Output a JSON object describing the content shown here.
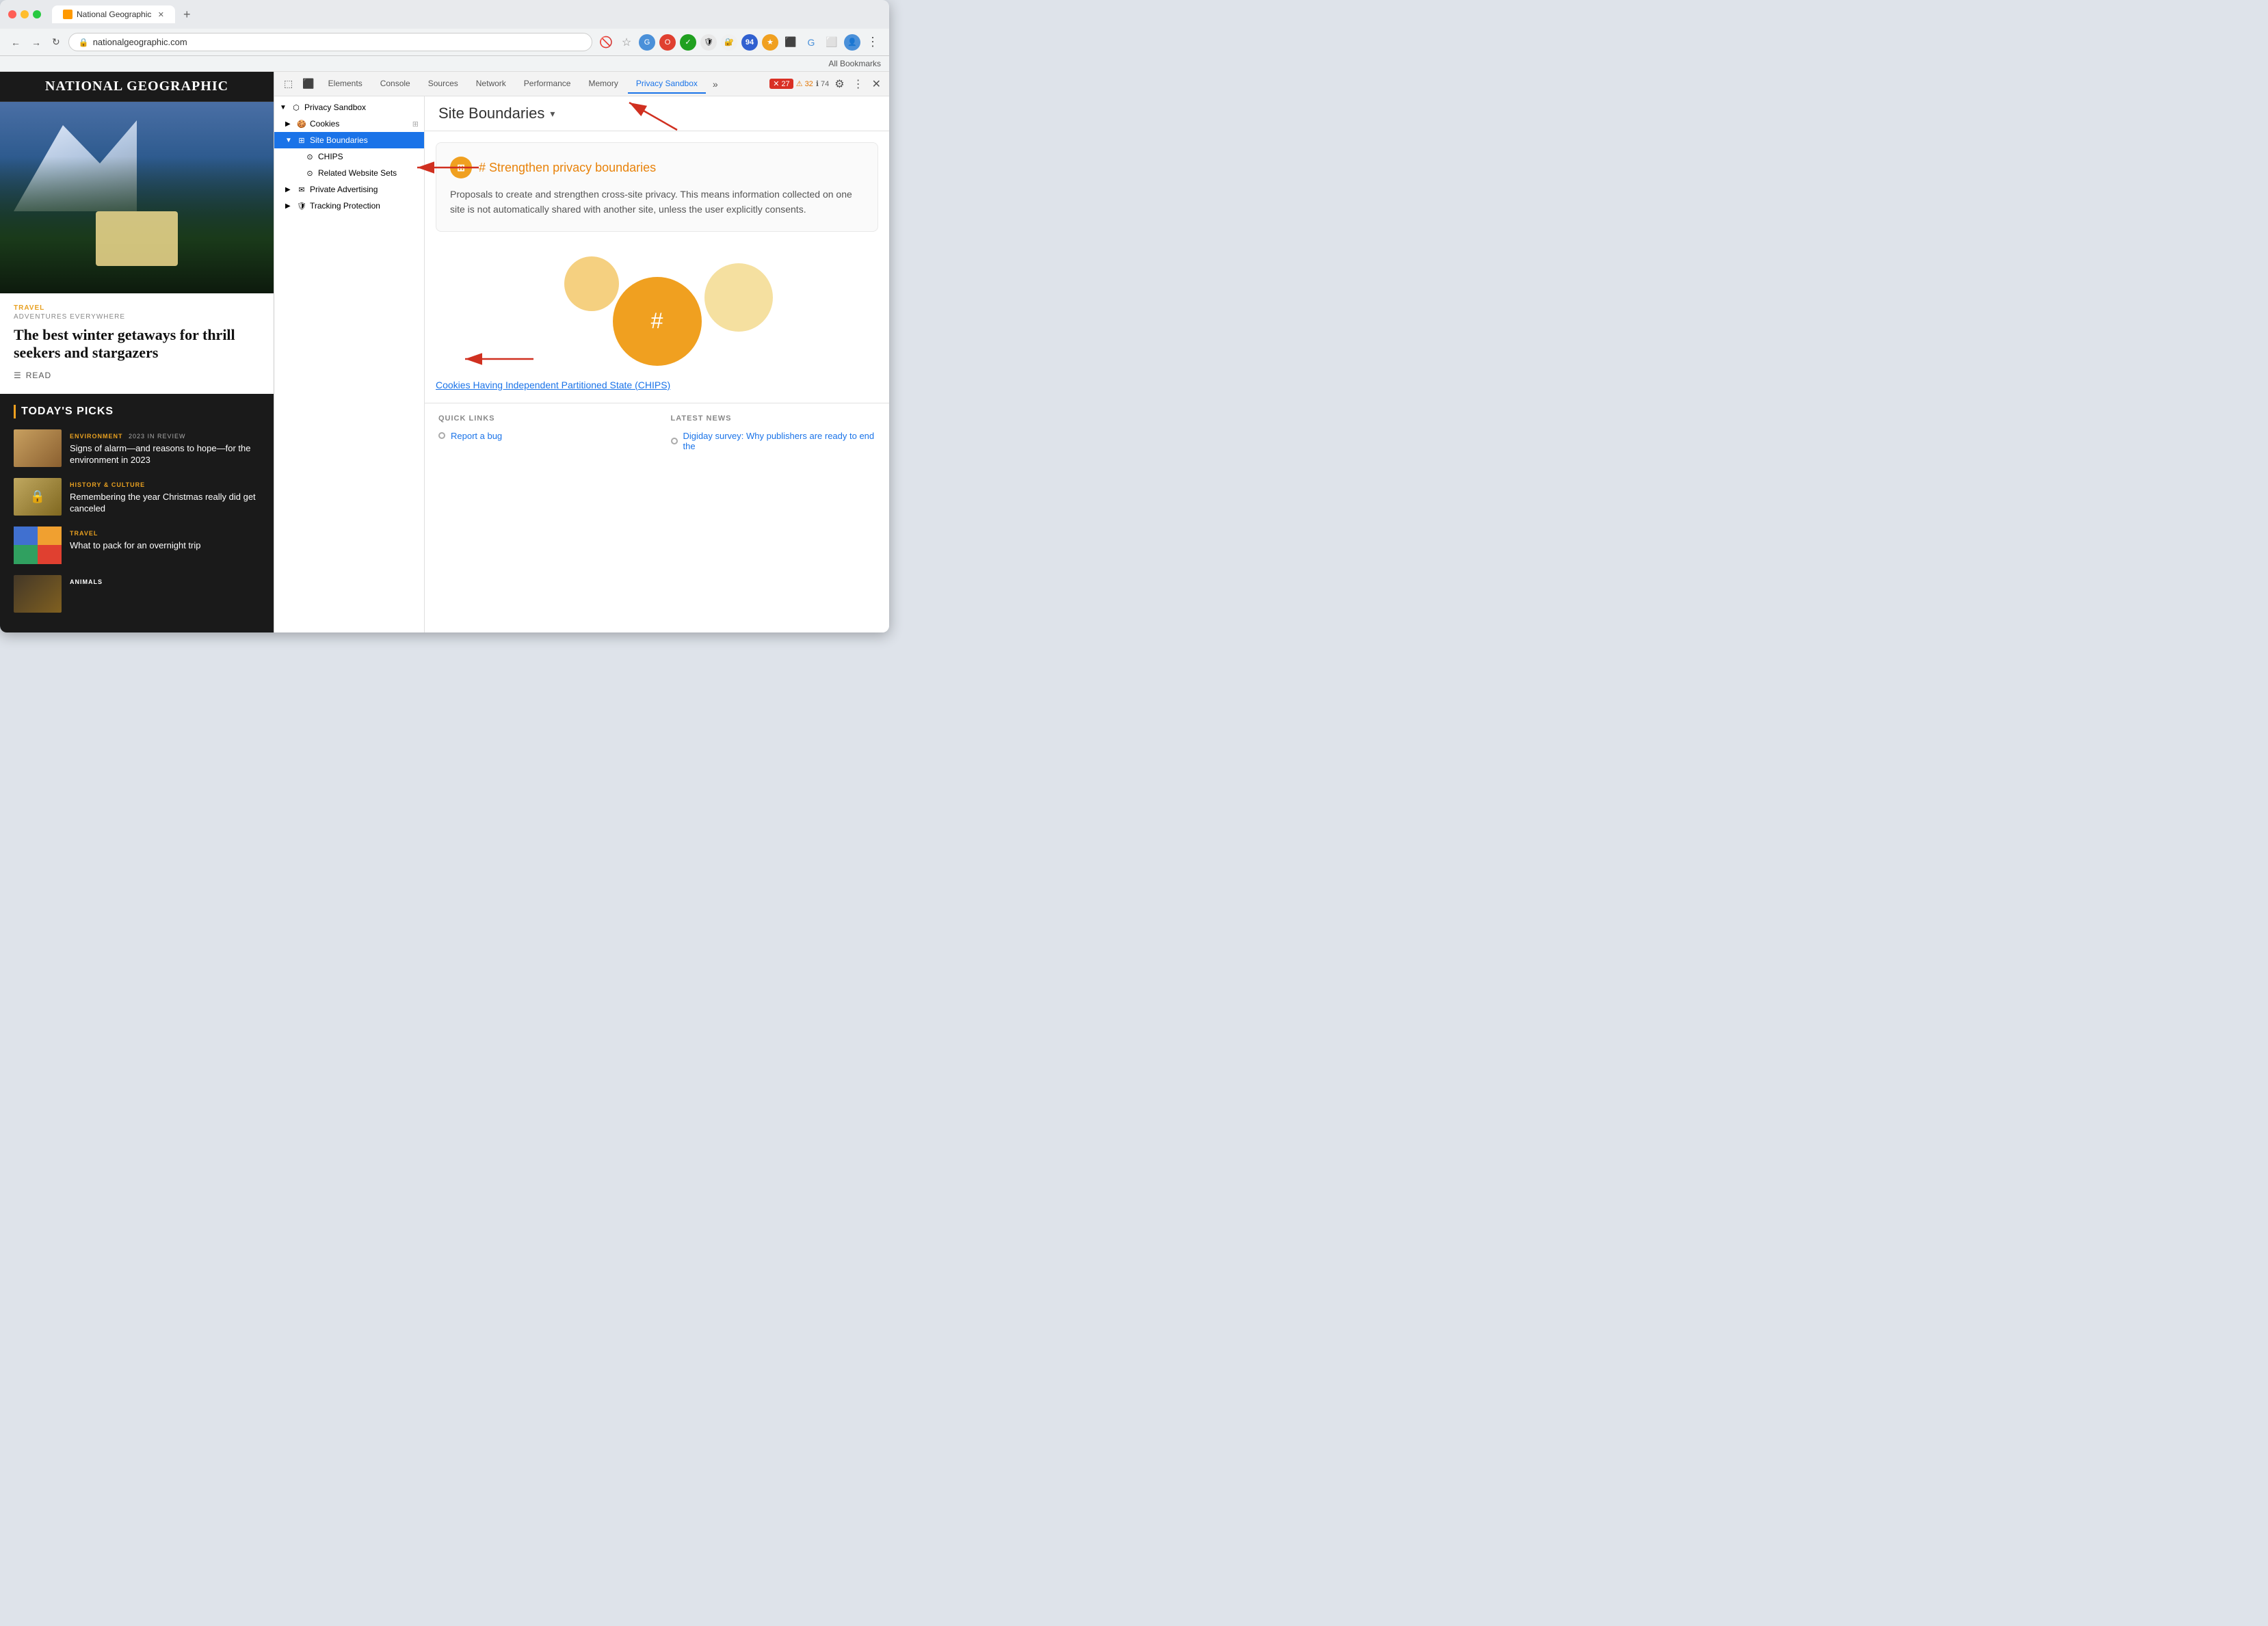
{
  "browser": {
    "tab_title": "National Geographic",
    "url": "nationalgeographic.com",
    "bookmarks_bar": "All Bookmarks"
  },
  "devtools": {
    "tabs": [
      "Elements",
      "Console",
      "Sources",
      "Network",
      "Performance",
      "Memory",
      "Privacy Sandbox"
    ],
    "active_tab": "Privacy Sandbox",
    "error_count": "27",
    "warn_count": "32",
    "info_count": "74"
  },
  "tree": {
    "items": [
      {
        "label": "Privacy Sandbox",
        "level": 0,
        "arrow": "▼",
        "selected": false
      },
      {
        "label": "Cookies",
        "level": 1,
        "arrow": "▶",
        "selected": false
      },
      {
        "label": "Site Boundaries",
        "level": 1,
        "arrow": "▼",
        "selected": true
      },
      {
        "label": "CHIPS",
        "level": 2,
        "arrow": "",
        "selected": false
      },
      {
        "label": "Related Website Sets",
        "level": 2,
        "arrow": "",
        "selected": false
      },
      {
        "label": "Private Advertising",
        "level": 1,
        "arrow": "▶",
        "selected": false
      },
      {
        "label": "Tracking Protection",
        "level": 1,
        "arrow": "▶",
        "selected": false
      }
    ]
  },
  "content": {
    "page_title": "Site Boundaries",
    "card_heading": "Strengthen privacy boundaries",
    "card_text": "Proposals to create and strengthen cross-site privacy. This means information collected on one site is not automatically shared with another site, unless the user explicitly consents.",
    "chips_link_text": "Cookies Having Independent Partitioned State (CHIPS)",
    "quick_links_title": "QUICK LINKS",
    "latest_news_title": "LATEST NEWS",
    "quick_links": [
      {
        "label": "Report a bug"
      }
    ],
    "latest_news": [
      {
        "label": "Digiday survey: Why publishers are ready to end the"
      }
    ]
  },
  "natgeo": {
    "logo": "National Geographic",
    "hero_tag": "TRAVEL",
    "hero_subtitle": "ADVENTURES EVERYWHERE",
    "hero_title": "The best winter getaways for thrill seekers and stargazers",
    "read_label": "READ",
    "picks_title": "TODAY'S PICKS",
    "picks": [
      {
        "tag": "ENVIRONMENT",
        "badge": "2023 IN REVIEW",
        "title": "Signs of alarm—and reasons to hope—for the environment in 2023"
      },
      {
        "tag": "HISTORY & CULTURE",
        "badge": "",
        "title": "Remembering the year Christmas really did get canceled"
      },
      {
        "tag": "TRAVEL",
        "badge": "",
        "title": "What to pack for an overnight trip"
      }
    ],
    "animals_tag": "ANIMALS"
  }
}
